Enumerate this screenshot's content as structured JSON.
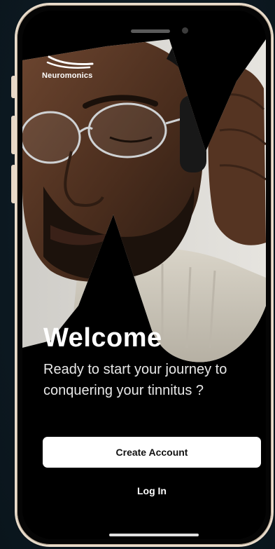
{
  "brand": {
    "name": "Neuromonics"
  },
  "welcome": {
    "title": "Welcome",
    "subtitle": "Ready to start your journey to conquering your tinnitus ?"
  },
  "actions": {
    "create_account_label": "Create Account",
    "login_label": "Log In"
  },
  "icons": {
    "logo_mark": "wave-logo-icon"
  },
  "colors": {
    "background": "#0e1a22",
    "phone_frame": "#e9dccb",
    "screen": "#000000",
    "primary_button": "#ffffff",
    "text": "#ffffff"
  }
}
